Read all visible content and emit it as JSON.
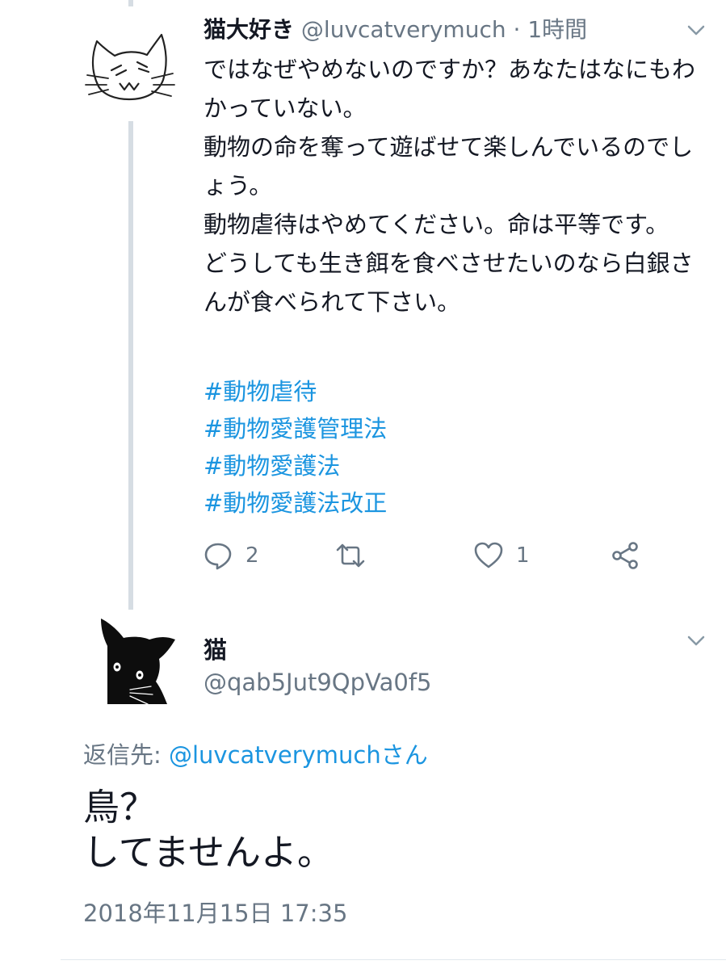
{
  "tweet1": {
    "author_name": "猫大好き",
    "handle": "@luvcatverymuch",
    "separator": "·",
    "time": "1時間",
    "body_lines": [
      "ではなぜやめないのですか？あなたはなにもわかっていない。",
      "動物の命を奪って遊ばせて楽しんでいるのでしょう。",
      "動物虐待はやめてください。命は平等です。",
      "どうしても生き餌を食べさせたいのなら白銀さんが食べられて下さい。"
    ],
    "hashtags": [
      "#動物虐待",
      "#動物愛護管理法",
      "#動物愛護法",
      "#動物愛護法改正"
    ],
    "actions": {
      "reply_count": "2",
      "retweet_count": "",
      "like_count": "1"
    },
    "icons": {
      "avatar": "cat-doodle-avatar",
      "menu": "chevron-down-icon",
      "reply": "reply-icon",
      "retweet": "retweet-icon",
      "like": "heart-icon",
      "share": "share-icon"
    }
  },
  "tweet2": {
    "author_name": "猫",
    "handle": "@qab5Jut9QpVa0f5",
    "reply_to_label": "返信先: ",
    "reply_to_link": "@luvcatverymuchさん",
    "body_lines": [
      "鳥？",
      "してませんよ。"
    ],
    "timestamp": "2018年11月15日 17:35",
    "icons": {
      "avatar": "black-cat-avatar",
      "menu": "chevron-down-icon"
    }
  },
  "colors": {
    "link": "#1b95e0",
    "secondary_text": "#687684",
    "primary_text": "#141823",
    "thread_line": "#d6dde3"
  }
}
